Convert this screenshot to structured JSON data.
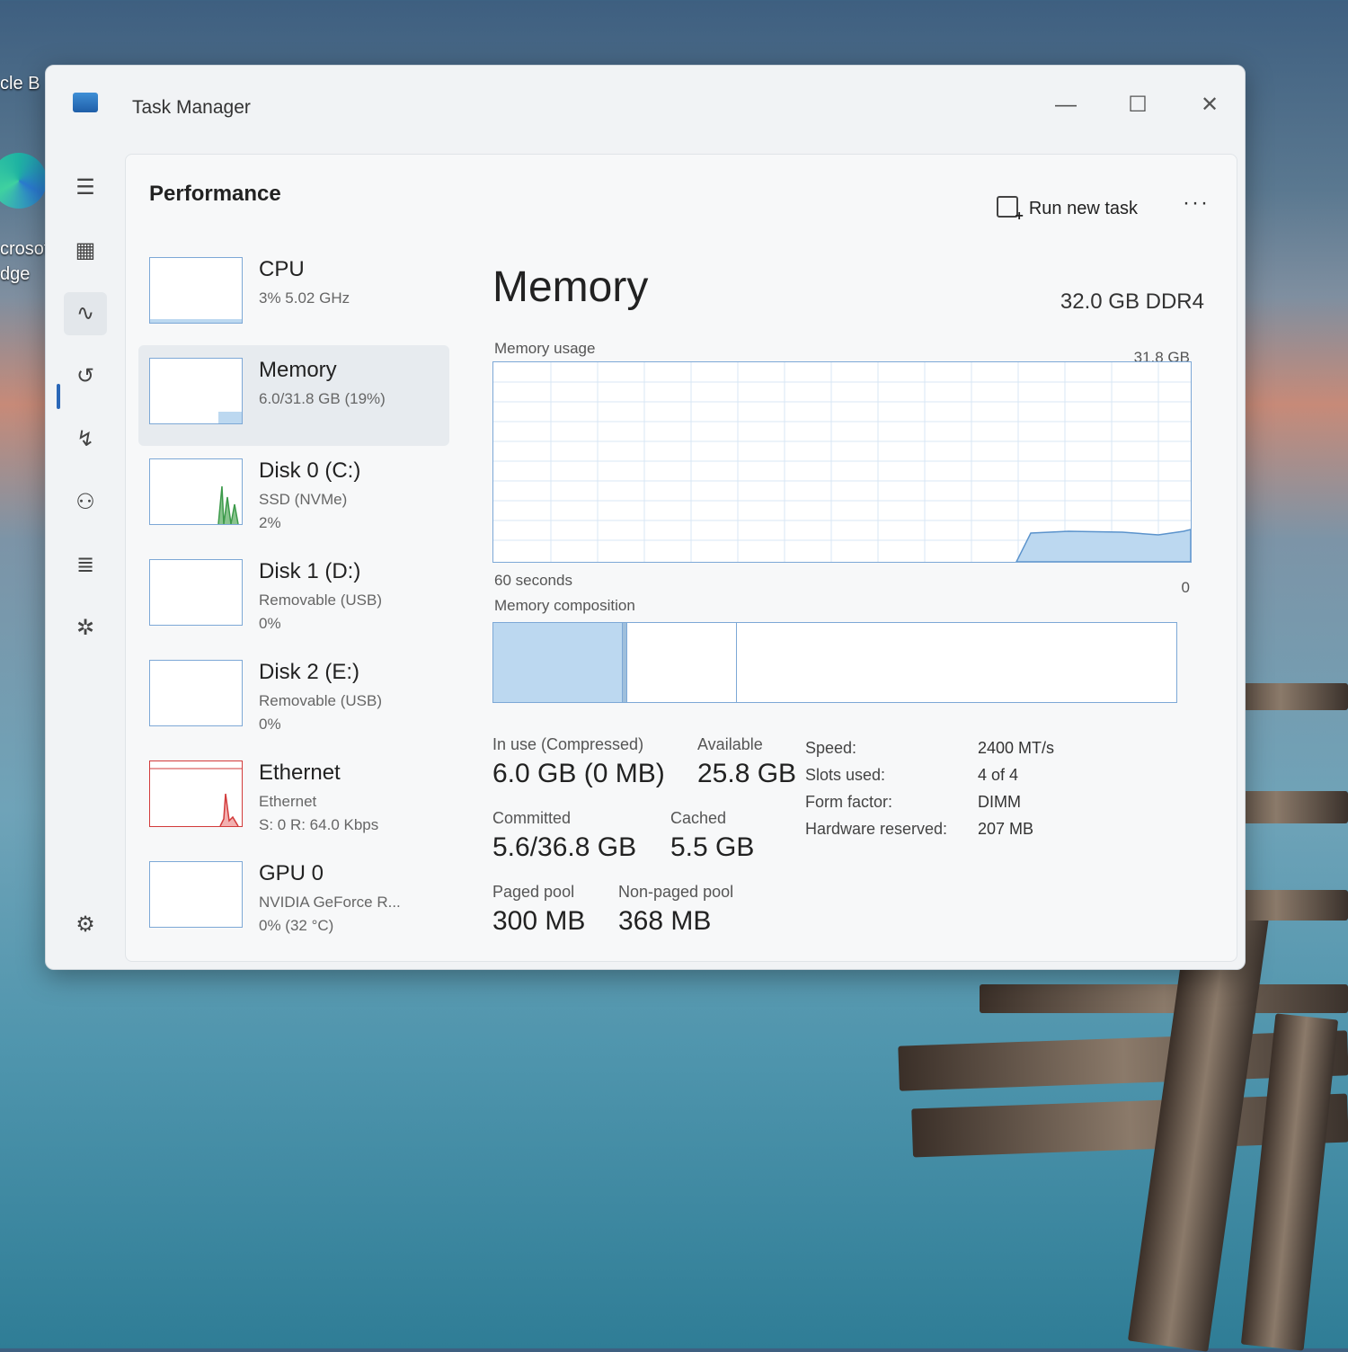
{
  "desktop": {
    "icons": [
      "cle B",
      "crosof",
      "dge"
    ]
  },
  "window": {
    "title": "Task Manager",
    "controls": {
      "minimize": "—",
      "maximize": "☐",
      "close": "✕"
    }
  },
  "nav": {
    "items": [
      "hamburger-menu",
      "processes",
      "performance",
      "app-history",
      "startup-apps",
      "users",
      "details",
      "services",
      "settings"
    ]
  },
  "header": {
    "title": "Performance",
    "run_new_task": "Run new task",
    "more": "···"
  },
  "perf_list": [
    {
      "name": "CPU",
      "sub1": "3%  5.02 GHz",
      "sub2": ""
    },
    {
      "name": "Memory",
      "sub1": "6.0/31.8 GB (19%)",
      "sub2": ""
    },
    {
      "name": "Disk 0 (C:)",
      "sub1": "SSD (NVMe)",
      "sub2": "2%"
    },
    {
      "name": "Disk 1 (D:)",
      "sub1": "Removable (USB)",
      "sub2": "0%"
    },
    {
      "name": "Disk 2 (E:)",
      "sub1": "Removable (USB)",
      "sub2": "0%"
    },
    {
      "name": "Ethernet",
      "sub1": "Ethernet",
      "sub2": "S: 0 R: 64.0 Kbps"
    },
    {
      "name": "GPU 0",
      "sub1": "NVIDIA GeForce R...",
      "sub2": "0%  (32 °C)"
    }
  ],
  "detail": {
    "title": "Memory",
    "total": "32.0 GB DDR4",
    "usage_label": "Memory usage",
    "usage_max": "31.8 GB",
    "axis_left": "60 seconds",
    "axis_right": "0",
    "composition_label": "Memory composition",
    "composition": {
      "in_use": 6.0,
      "modified": 0.2,
      "standby": 5.5,
      "free": 20.1
    },
    "stats": {
      "in_use_label": "In use (Compressed)",
      "in_use_value": "6.0 GB (0 MB)",
      "available_label": "Available",
      "available_value": "25.8 GB",
      "committed_label": "Committed",
      "committed_value": "5.6/36.8 GB",
      "cached_label": "Cached",
      "cached_value": "5.5 GB",
      "paged_label": "Paged pool",
      "paged_value": "300 MB",
      "nonpaged_label": "Non-paged pool",
      "nonpaged_value": "368 MB"
    },
    "specs": [
      {
        "label": "Speed:",
        "value": "2400 MT/s"
      },
      {
        "label": "Slots used:",
        "value": "4 of 4"
      },
      {
        "label": "Form factor:",
        "value": "DIMM"
      },
      {
        "label": "Hardware reserved:",
        "value": "207 MB"
      }
    ]
  },
  "colors": {
    "accent": "#2a67b7",
    "graph_line": "#7da8d6",
    "graph_fill": "#bcd8f0",
    "ethernet": "#d23b3b",
    "disk": "#3c9a4a"
  }
}
